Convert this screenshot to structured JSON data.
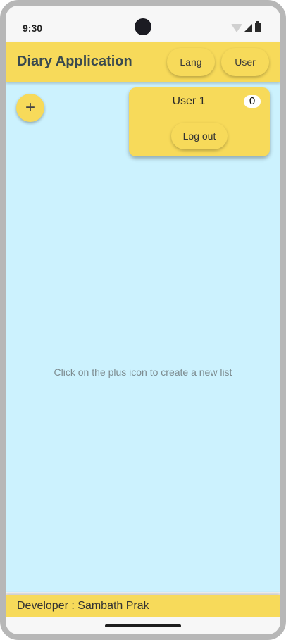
{
  "status_bar": {
    "time": "9:30",
    "icons": [
      "wifi-icon",
      "signal-icon",
      "battery-icon"
    ]
  },
  "app_bar": {
    "title": "Diary Application",
    "lang_label": "Lang",
    "user_label": "User"
  },
  "main": {
    "add_icon": "+",
    "empty_hint": "Click on the plus icon to create a new list"
  },
  "user_panel": {
    "user_name": "User 1",
    "count": "0",
    "logout_label": "Log out"
  },
  "footer": {
    "text": "Developer : Sambath Prak"
  },
  "colors": {
    "accent": "#f7da5a",
    "content_bg": "#ccf2fe",
    "title_text": "#3a4a4f"
  }
}
